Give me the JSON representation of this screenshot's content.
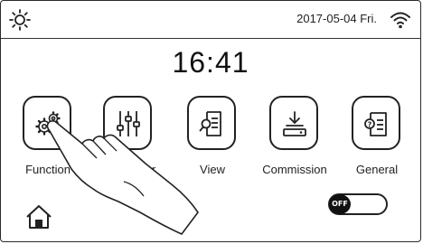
{
  "status_bar": {
    "datetime": "2017-05-04 Fri.",
    "left_icon": "sun-icon",
    "right_icon": "wifi-icon"
  },
  "clock": "16:41",
  "menu": [
    {
      "label": "Function",
      "icon": "gears-icon"
    },
    {
      "label": "Parameter",
      "icon": "sliders-icon"
    },
    {
      "label": "View",
      "icon": "document-search-icon"
    },
    {
      "label": "Commission",
      "icon": "download-tray-icon"
    },
    {
      "label": "General",
      "icon": "info-document-icon"
    }
  ],
  "bottom": {
    "home_icon": "home-icon",
    "toggle_label": "OFF",
    "toggle_state": "off"
  }
}
